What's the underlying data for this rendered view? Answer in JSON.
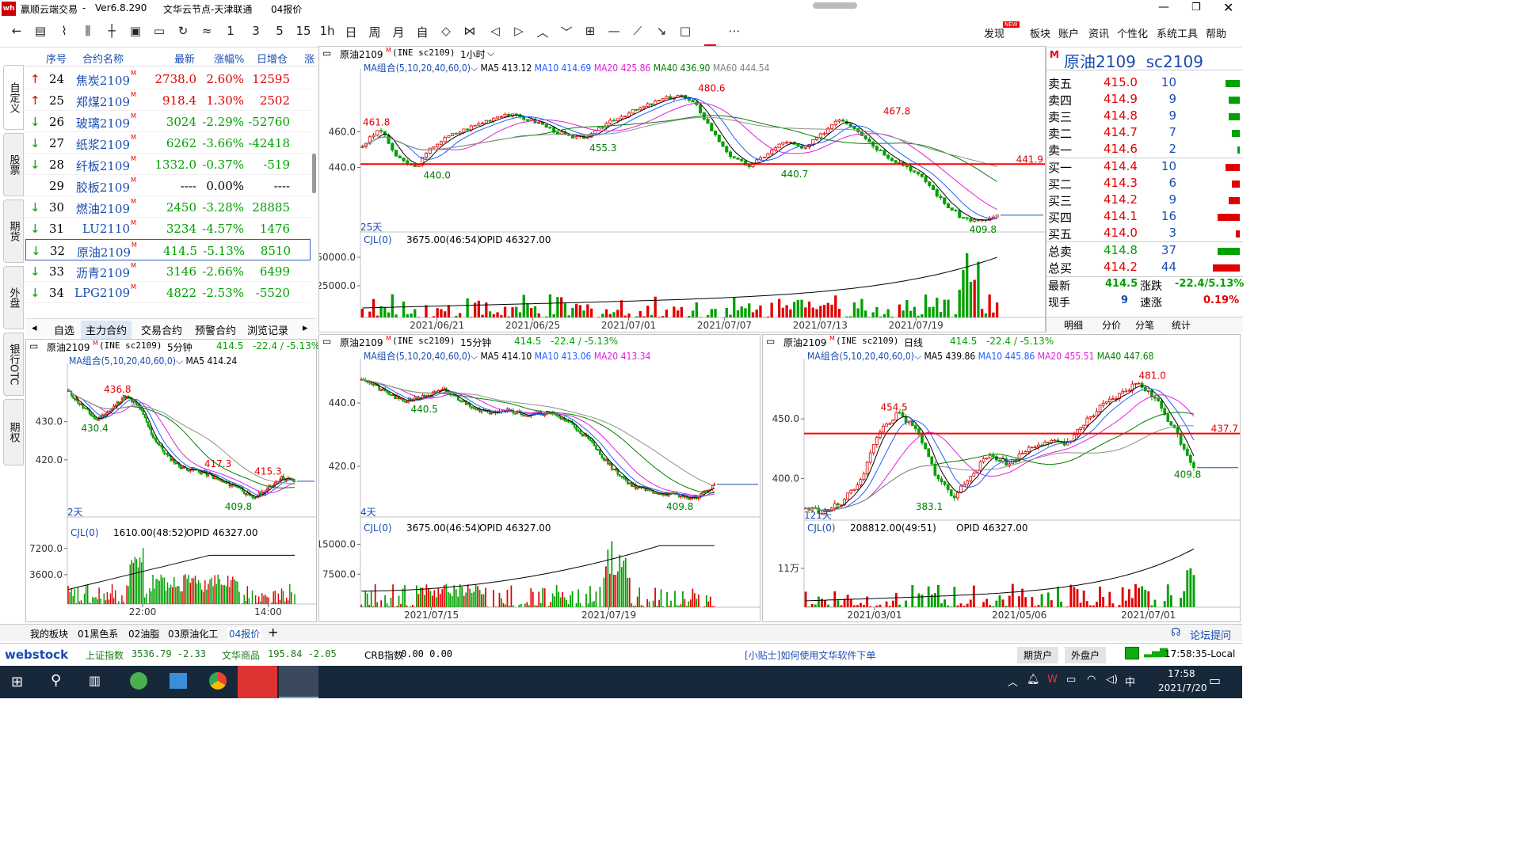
{
  "app": {
    "title": "赢顺云端交易",
    "version": "Ver6.8.290",
    "node": "文华云节点-天津联通",
    "page": "04报价"
  },
  "toolbar": {
    "icons": [
      "back",
      "list",
      "line",
      "kline",
      "bars",
      "bars2",
      "save",
      "refresh",
      "tick",
      "1",
      "3",
      "5",
      "15",
      "1h",
      "日",
      "周",
      "月",
      "自",
      "expand",
      "shrink",
      "left",
      "right",
      "up",
      "down",
      "grid",
      "line-tool",
      "ray",
      "slant",
      "rect",
      "color",
      "more"
    ],
    "period_labels": [
      "1",
      "3",
      "5",
      "15",
      "1h",
      "日",
      "周",
      "月",
      "自"
    ],
    "menu": [
      "发现",
      "板块",
      "账户",
      "资讯",
      "个性化",
      "系统工具",
      "帮助"
    ],
    "new_badge": "NEW"
  },
  "vtabs": [
    "自定义",
    "股票",
    "期货",
    "外盘",
    "银行OTC",
    "期权"
  ],
  "table": {
    "headers": [
      "序号",
      "合约名称",
      "最新",
      "涨幅%",
      "日增仓",
      "涨"
    ],
    "rows": [
      {
        "dir": "up",
        "no": "24",
        "name": "焦炭2109",
        "sup": "M",
        "last": "2738.0",
        "chg": "2.60%",
        "oi": "12595",
        "c": "red"
      },
      {
        "dir": "up",
        "no": "25",
        "name": "郑煤2109",
        "sup": "M",
        "last": "918.4",
        "chg": "1.30%",
        "oi": "2502",
        "c": "red"
      },
      {
        "dir": "down",
        "no": "26",
        "name": "玻璃2109",
        "sup": "M",
        "last": "3024",
        "chg": "-2.29%",
        "oi": "-52760",
        "c": "green"
      },
      {
        "dir": "down",
        "no": "27",
        "name": "纸浆2109",
        "sup": "M",
        "last": "6262",
        "chg": "-3.66%",
        "oi": "-42418",
        "c": "green"
      },
      {
        "dir": "down",
        "no": "28",
        "name": "纤板2109",
        "sup": "M",
        "last": "1332.0",
        "chg": "-0.37%",
        "oi": "-519",
        "c": "green"
      },
      {
        "dir": "",
        "no": "29",
        "name": "胶板2109",
        "sup": "M",
        "last": "----",
        "chg": "0.00%",
        "oi": "----",
        "c": "black"
      },
      {
        "dir": "down",
        "no": "30",
        "name": "燃油2109",
        "sup": "M",
        "last": "2450",
        "chg": "-3.28%",
        "oi": "28885",
        "c": "green"
      },
      {
        "dir": "down",
        "no": "31",
        "name": "LU2110",
        "sup": "M",
        "last": "3234",
        "chg": "-4.57%",
        "oi": "1476",
        "c": "green"
      },
      {
        "dir": "down",
        "no": "32",
        "name": "原油2109",
        "sup": "M",
        "last": "414.5",
        "chg": "-5.13%",
        "oi": "8510",
        "c": "green"
      },
      {
        "dir": "down",
        "no": "33",
        "name": "沥青2109",
        "sup": "M",
        "last": "3146",
        "chg": "-2.66%",
        "oi": "6499",
        "c": "green"
      },
      {
        "dir": "down",
        "no": "34",
        "name": "LPG2109",
        "sup": "M",
        "last": "4822",
        "chg": "-2.53%",
        "oi": "-5520",
        "c": "green"
      }
    ]
  },
  "subtabs": [
    "自选",
    "主力合约",
    "交易合约",
    "预警合约",
    "浏览记录"
  ],
  "main_chart": {
    "symbol": "原油2109",
    "sup": "M",
    "code": "(INE sc2109)",
    "period": "1小时",
    "ma_combo": "MA组合(5,10,20,40,60,0)",
    "ma5": "MA5 413.12",
    "ma10": "MA10 414.69",
    "ma20": "MA20 425.86",
    "ma40": "MA40 436.90",
    "ma60": "MA60 444.54",
    "y_ticks": [
      "460.0",
      "440.0"
    ],
    "annotations": [
      "461.8",
      "480.6",
      "467.8",
      "455.3",
      "440.0",
      "440.7",
      "409.8"
    ],
    "hline": "441.9",
    "days": "25天",
    "vol_label": "CJL(0)",
    "vol_info": "3675.00(46:54)",
    "opid": "OPID 46327.00",
    "vol_ticks": [
      "50000.0",
      "25000.0"
    ],
    "dates": [
      "2021/06/21",
      "2021/06/25",
      "2021/07/01",
      "2021/07/07",
      "2021/07/13",
      "2021/07/19"
    ]
  },
  "chart5": {
    "symbol": "原油2109",
    "sup": "M",
    "code": "(INE sc2109)",
    "period": "5分钟",
    "last": "414.5",
    "chg": "-22.4 / -5.13%",
    "ma_combo": "MA组合(5,10,20,40,60,0)",
    "ma5": "MA5 414.24",
    "y_ticks": [
      "430.0",
      "420.0"
    ],
    "annotations": [
      "436.8",
      "430.4",
      "417.3",
      "415.3",
      "409.8"
    ],
    "days": "2天",
    "vol_label": "CJL(0)",
    "vol_info": "1610.00(48:52)",
    "opid": "OPID 46327.00",
    "vol_ticks": [
      "7200.0",
      "3600.0"
    ],
    "times": [
      "22:00",
      "14:00"
    ]
  },
  "chart15": {
    "symbol": "原油2109",
    "sup": "M",
    "code": "(INE sc2109)",
    "period": "15分钟",
    "last": "414.5",
    "chg": "-22.4 / -5.13%",
    "ma_combo": "MA组合(5,10,20,40,60,0)",
    "ma5": "MA5 414.10",
    "ma10": "MA10 413.06",
    "ma20": "MA20 413.34",
    "y_ticks": [
      "440.0",
      "420.0"
    ],
    "annotations": [
      "440.5",
      "409.8"
    ],
    "days": "4天",
    "vol_label": "CJL(0)",
    "vol_info": "3675.00(46:54)",
    "opid": "OPID 46327.00",
    "vol_ticks": [
      "15000.0",
      "7500.0"
    ],
    "dates": [
      "2021/07/15",
      "2021/07/19"
    ]
  },
  "chartD": {
    "symbol": "原油2109",
    "sup": "M",
    "code": "(INE sc2109)",
    "period": "日线",
    "last": "414.5",
    "chg": "-22.4 / -5.13%",
    "ma_combo": "MA组合(5,10,20,40,60,0)",
    "ma5": "MA5 439.86",
    "ma10": "MA10 445.86",
    "ma20": "MA20 455.51",
    "ma40": "MA40 447.68",
    "y_ticks": [
      "450.0",
      "400.0"
    ],
    "annotations": [
      "454.5",
      "481.0",
      "383.1",
      "409.8"
    ],
    "hline": "437.7",
    "days": "121天",
    "vol_label": "CJL(0)",
    "vol_info": "208812.00(49:51)",
    "opid": "OPID 46327.00",
    "vol_ticks": [
      "11万"
    ],
    "dates": [
      "2021/03/01",
      "2021/05/06",
      "2021/07/01"
    ]
  },
  "quote": {
    "badge": "M",
    "title": "原油2109  sc2109",
    "asks": [
      {
        "l": "卖五",
        "p": "415.0",
        "v": "10",
        "w": 18
      },
      {
        "l": "卖四",
        "p": "414.9",
        "v": "9",
        "w": 14
      },
      {
        "l": "卖三",
        "p": "414.8",
        "v": "9",
        "w": 14
      },
      {
        "l": "卖二",
        "p": "414.7",
        "v": "7",
        "w": 10
      },
      {
        "l": "卖一",
        "p": "414.6",
        "v": "2",
        "w": 3
      }
    ],
    "bids": [
      {
        "l": "买一",
        "p": "414.4",
        "v": "10",
        "w": 18
      },
      {
        "l": "买二",
        "p": "414.3",
        "v": "6",
        "w": 10
      },
      {
        "l": "买三",
        "p": "414.2",
        "v": "9",
        "w": 14
      },
      {
        "l": "买四",
        "p": "414.1",
        "v": "16",
        "w": 28
      },
      {
        "l": "买五",
        "p": "414.0",
        "v": "3",
        "w": 5
      }
    ],
    "total_sell": {
      "l": "总卖",
      "p": "414.8",
      "v": "37"
    },
    "total_buy": {
      "l": "总买",
      "p": "414.2",
      "v": "44"
    },
    "latest_l": "最新",
    "latest": "414.5",
    "change_l": "涨跌",
    "change": "-22.4/5.13%",
    "now_l": "现手",
    "now": "9",
    "speed_l": "速涨",
    "speed": "0.19%",
    "tabs": [
      "明细",
      "分价",
      "分笔",
      "统计"
    ]
  },
  "bottom": {
    "tabs": [
      "我的板块",
      "01黑色系",
      "02油脂",
      "03原油化工",
      "04报价"
    ],
    "add": "+",
    "forum": "论坛提问"
  },
  "status": {
    "logo": "webstock",
    "idx1_l": "上证指数",
    "idx1": "3536.79 -2.33",
    "idx2_l": "文华商品",
    "idx2": "195.84 -2.05",
    "idx3_l": "CRB指数",
    "idx3": "0.00 0.00",
    "tip": "[小贴士]如何使用文华软件下单",
    "btn1": "期货户",
    "btn2": "外盘户",
    "time": "17:58:35-Local"
  },
  "taskbar": {
    "time": "17:58",
    "date": "2021/7/20",
    "ime": "中"
  },
  "colors": {
    "up": "#e00000",
    "down": "#00a000",
    "blue": "#1a4cb0",
    "ma10": "#2060ff",
    "ma20": "#e020e0",
    "ma40": "#008000",
    "ma60": "#808080"
  }
}
